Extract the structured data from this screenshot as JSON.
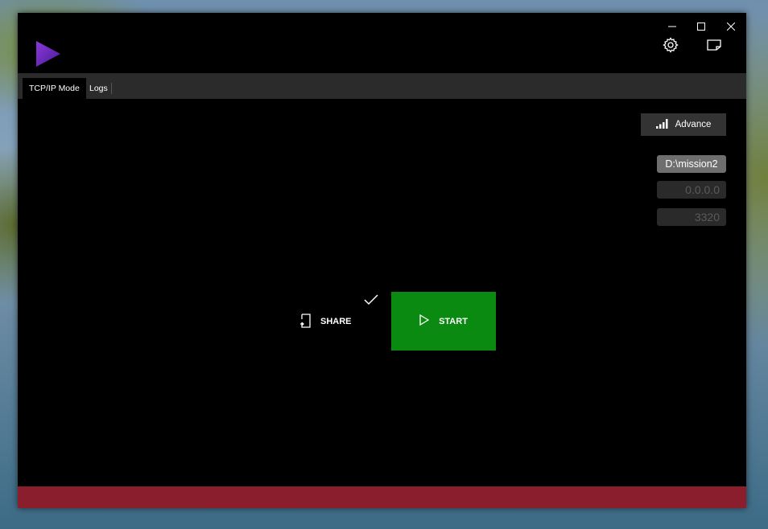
{
  "window": {
    "minimize_icon": "minimize-icon",
    "maximize_icon": "maximize-icon",
    "close_icon": "close-icon"
  },
  "header": {
    "logo_icon": "play-logo-icon",
    "settings_icon": "gear-icon",
    "notes_icon": "note-icon"
  },
  "tabs": [
    {
      "label": "TCP/IP Mode",
      "active": true
    },
    {
      "label": "Logs",
      "active": false
    }
  ],
  "advance": {
    "label": "Advance",
    "icon": "signal-bars-icon"
  },
  "fields": {
    "path": {
      "value": "D:\\mission2"
    },
    "ip": {
      "value": "0.0.0.0"
    },
    "port": {
      "value": "3320"
    }
  },
  "actions": {
    "share_label": "SHARE",
    "share_icon": "share-device-icon",
    "check_icon": "checkmark-icon",
    "start_label": "START",
    "start_icon": "play-outline-icon"
  },
  "colors": {
    "accent_green": "#0a8a10",
    "footer_red": "#8a1e2c",
    "logo_purple": "#6a2bbf"
  }
}
